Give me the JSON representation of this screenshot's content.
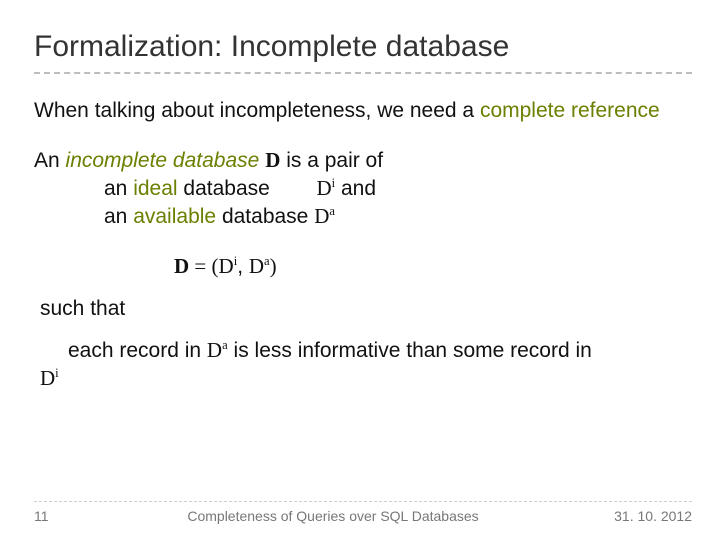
{
  "title": "Formalization: Incomplete database",
  "intro": {
    "lead": "When talking about incompleteness, we need a ",
    "emph": "complete reference"
  },
  "defn": {
    "lead1": "An ",
    "emph1": "incomplete database",
    "sym_D": "D",
    "tail1": " is a pair of",
    "line2a": "an ",
    "line2b": "ideal",
    "line2c": " database        ",
    "sym_Di_base": "D",
    "sym_Di_sup": "i",
    "line2d": "  and",
    "line3a": "an ",
    "line3b": "available",
    "line3c": " database ",
    "sym_Da_base": "D",
    "sym_Da_sup": "a"
  },
  "equation": {
    "D": "D",
    "eq": " = (",
    "Di_base": "D",
    "Di_sup": "i",
    "comma": ", ",
    "Da_base": "D",
    "Da_sup": "a",
    "close": ")"
  },
  "cond": {
    "lead": "such that",
    "rec_a": "each record in ",
    "Da_base": "D",
    "Da_sup": "a",
    "rec_b": "  is less informative than some record in ",
    "Di_base": "D",
    "Di_sup": "i"
  },
  "footer": {
    "page": "11",
    "center": "Completeness of Queries over SQL Databases",
    "date": "31. 10. 2012"
  }
}
